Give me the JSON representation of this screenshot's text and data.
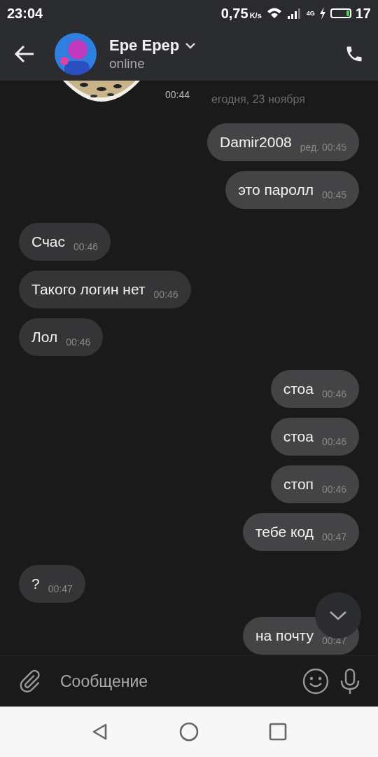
{
  "status_bar": {
    "time": "23:04",
    "speed": "0,75",
    "speed_unit": "K/s",
    "network": "4G",
    "battery": "17"
  },
  "header": {
    "name": "Epe Epep",
    "status": "online"
  },
  "sticker": {
    "kind": "picture",
    "time": "00:44"
  },
  "date_label": "егодня, 23 ноября",
  "messages": [
    {
      "outgoing": true,
      "text": "Damir2008",
      "time": "ред. 00:45"
    },
    {
      "outgoing": true,
      "text": "это паролл",
      "time": "00:45"
    },
    {
      "outgoing": false,
      "text": "Счас",
      "time": "00:46"
    },
    {
      "outgoing": false,
      "text": "Такого логин нет",
      "time": "00:46"
    },
    {
      "outgoing": false,
      "text": "Лол",
      "time": "00:46"
    },
    {
      "outgoing": true,
      "text": "стоа",
      "time": "00:46"
    },
    {
      "outgoing": true,
      "text": "стоа",
      "time": "00:46"
    },
    {
      "outgoing": true,
      "text": "стоп",
      "time": "00:46"
    },
    {
      "outgoing": true,
      "text": "тебе код",
      "time": "00:47"
    },
    {
      "outgoing": false,
      "text": "?",
      "time": "00:47"
    },
    {
      "outgoing": true,
      "text": "на почту",
      "time": "00:47"
    }
  ],
  "composer": {
    "placeholder": "Сообщение"
  }
}
